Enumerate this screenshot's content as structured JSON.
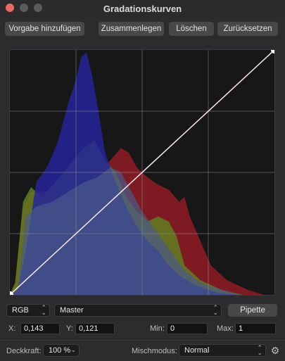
{
  "window": {
    "title": "Gradationskurven"
  },
  "toolbar": {
    "add_preset": "Vorgabe hinzufügen",
    "merge": "Zusammenlegen",
    "delete": "Löschen",
    "reset": "Zurücksetzen"
  },
  "curve": {
    "points": [
      [
        0,
        0
      ],
      [
        1,
        1
      ]
    ],
    "grid_divisions": 4
  },
  "histogram_colors": {
    "blue": "#24249a",
    "green": "#3f8a2e",
    "red": "#8a1c24",
    "combined": "#5a5a86"
  },
  "channel": {
    "mode": "RGB",
    "target": "Master",
    "picker_label": "Pipette"
  },
  "coords": {
    "x_label": "X:",
    "x_value": "0,143",
    "y_label": "Y:",
    "y_value": "0,121"
  },
  "range": {
    "min_label": "Min:",
    "min_value": "0",
    "max_label": "Max:",
    "max_value": "1"
  },
  "footer": {
    "opacity_label": "Deckkraft:",
    "opacity_value": "100 %",
    "blend_label": "Mischmodus:",
    "blend_value": "Normal"
  },
  "icons": {
    "settings": "gear-icon"
  }
}
